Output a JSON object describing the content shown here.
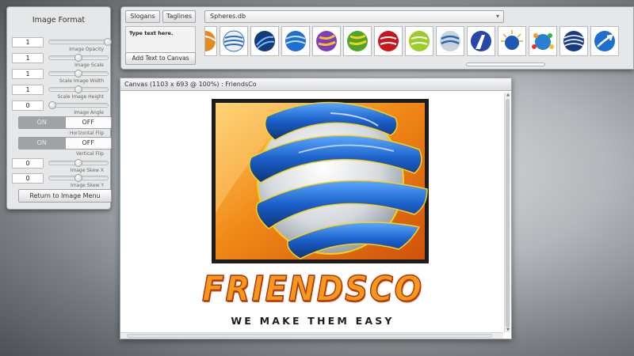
{
  "image_panel": {
    "title": "Image Format",
    "controls": [
      {
        "value": "1",
        "label": "Image Opacity",
        "level": 1.0
      },
      {
        "value": "1",
        "label": "Image Scale",
        "level": 0.5
      },
      {
        "value": "1",
        "label": "Scale Image Width",
        "level": 0.5
      },
      {
        "value": "1",
        "label": "Scale Image Height",
        "level": 0.5
      },
      {
        "value": "0",
        "label": "Image Angle",
        "level": 0.0
      }
    ],
    "horizontal_flip": {
      "on": "ON",
      "off": "OFF",
      "label": "Horizontal Flip"
    },
    "vertical_flip": {
      "on": "ON",
      "off": "OFF",
      "label": "Vertical Flip"
    },
    "skews": [
      {
        "value": "0",
        "label": "Image Skew X",
        "level": 0.5
      },
      {
        "value": "0",
        "label": "Image Skew Y",
        "level": 0.5
      }
    ],
    "return_button": "Return to Image Menu"
  },
  "text_panel": {
    "slogans_tab": "Slogans",
    "taglines_tab": "Taglines",
    "text_placeholder": "Type text here.",
    "add_button": "Add Text to Canvas",
    "database": "Spheres.db",
    "thumbnail_icons": [
      "sphere-partial-icon",
      "sphere-white-stripes-icon",
      "sphere-blue-swirl-icon",
      "sphere-blue-icon",
      "sphere-purple-yellow-icon",
      "sphere-green-yellow-icon",
      "sphere-red-icon",
      "sphere-lime-icon",
      "sphere-silver-blue-icon",
      "sphere-road-icon",
      "sphere-sunburst-icon",
      "sphere-people-icon",
      "sphere-navy-stripes-icon",
      "sphere-arrow-icon"
    ]
  },
  "canvas": {
    "title": "Canvas (1103 x 693 @ 100%) : FriendsCo",
    "brand_name": "FRIENDSCO",
    "tagline": "WE MAKE THEM EASY"
  },
  "colors": {
    "brand_orange": "#f39a1e",
    "brand_outline": "#b3370e",
    "sphere_blue": "#1b5fc4",
    "frame_orange": "#e57d0f"
  }
}
